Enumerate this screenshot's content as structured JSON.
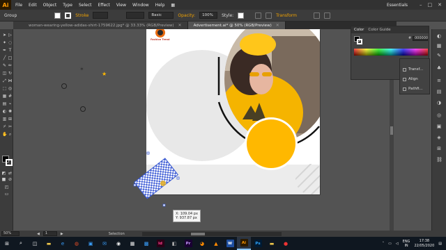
{
  "app": {
    "logo": "Ai",
    "workspace": "Essentials"
  },
  "menu": [
    "File",
    "Edit",
    "Object",
    "Type",
    "Select",
    "Effect",
    "View",
    "Window",
    "Help"
  ],
  "control": {
    "selection": "Group",
    "stroke_label": "Stroke",
    "brush": "Basic",
    "opacity_label": "Opacity:",
    "opacity_value": "100%",
    "style_label": "Style:",
    "transform_label": "Transform"
  },
  "tabs": [
    {
      "label": "woman-wearing-yellow-adidas-shirt-1759622.jpg* @ 33.33% (RGB/Preview)",
      "active": false
    },
    {
      "label": "Advertisement.ai* @ 50% (RGB/Preview)",
      "active": true
    }
  ],
  "artboard": {
    "brand_name": "Fashion Trend"
  },
  "color_panel": {
    "tabs": [
      "Color",
      "Color Guide"
    ],
    "hex": "000000"
  },
  "side_panel": {
    "items": [
      "Transf...",
      "Align",
      "Pathfi..."
    ]
  },
  "measure": {
    "x": "X: 109.04 px",
    "y": "Y: 937.87 px"
  },
  "status": {
    "zoom": "50%",
    "page": "1",
    "mode": "Selection"
  },
  "taskbar": {
    "apps": [
      "Ai",
      "Ps",
      "Pr",
      "W"
    ],
    "lang": "ENG",
    "region": "IN",
    "time": "17:38",
    "date": "22/05/2020"
  },
  "colors": {
    "accent_yellow": "#FFB800",
    "ui_dark": "#323232",
    "canvas": "#535353"
  }
}
